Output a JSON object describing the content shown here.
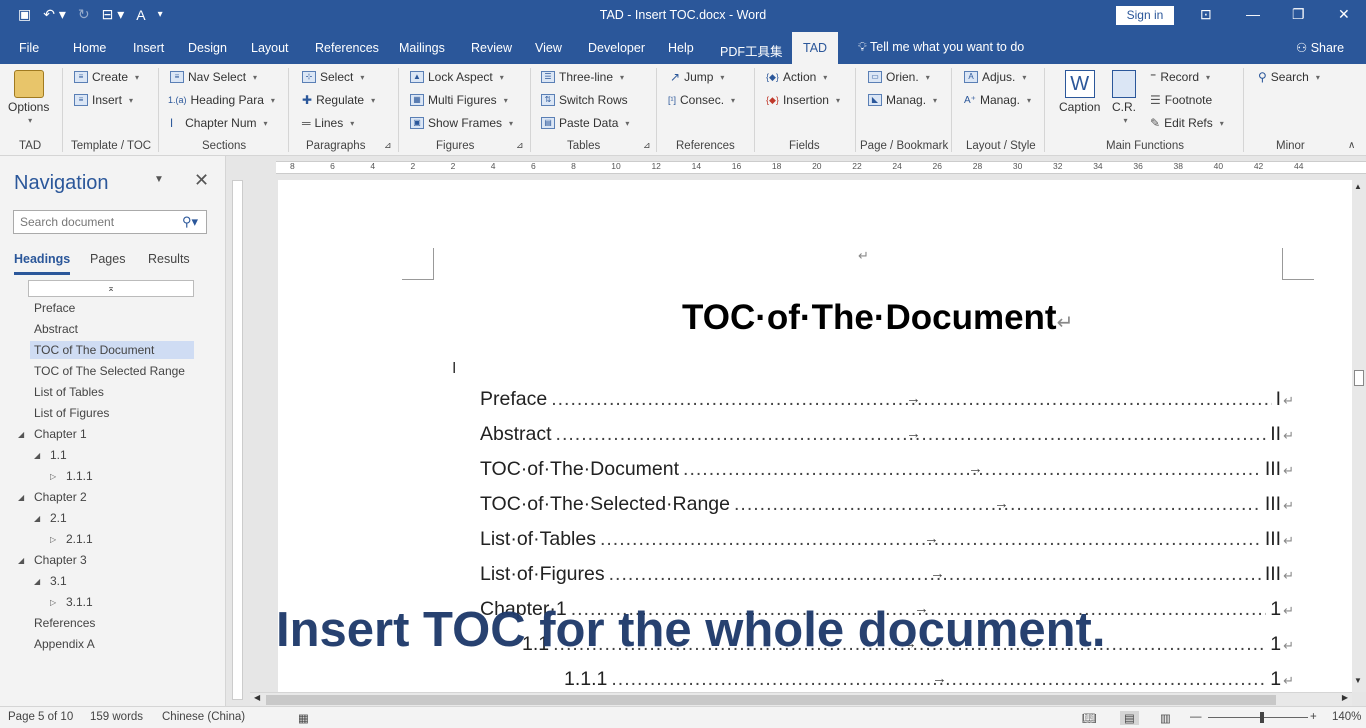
{
  "titlebar": {
    "title": "TAD - Insert TOC.docx - Word",
    "signin": "Sign in",
    "qat_icons": [
      "save-icon",
      "undo-icon",
      "redo-icon",
      "format-icon",
      "customize-icon"
    ]
  },
  "tabs": [
    "File",
    "Home",
    "Insert",
    "Design",
    "Layout",
    "References",
    "Mailings",
    "Review",
    "View",
    "Developer",
    "Help",
    "PDF工具集",
    "TAD"
  ],
  "active_tab": "TAD",
  "tellme": "Tell me what you want to do",
  "share": "Share",
  "ribbon": {
    "tad": {
      "options": "Options",
      "group": "TAD"
    },
    "template_toc": {
      "create": "Create",
      "insert": "Insert",
      "group": "Template / TOC"
    },
    "sections": {
      "nav_select": "Nav Select",
      "heading_para": "Heading Para",
      "chapter_num": "Chapter Num",
      "group": "Sections"
    },
    "paragraphs": {
      "select": "Select",
      "regulate": "Regulate",
      "lines": "Lines",
      "group": "Paragraphs"
    },
    "figures": {
      "lock_aspect": "Lock Aspect",
      "multi_figures": "Multi Figures",
      "show_frames": "Show Frames",
      "group": "Figures"
    },
    "tables": {
      "three_line": "Three-line",
      "switch_rows": "Switch Rows",
      "paste_data": "Paste Data",
      "group": "Tables"
    },
    "references": {
      "jump": "Jump",
      "consec": "Consec.",
      "group": "References"
    },
    "fields": {
      "action": "Action",
      "insertion": "Insertion",
      "group": "Fields"
    },
    "page_bookmark": {
      "orien": "Orien.",
      "manag": "Manag.",
      "group": "Page / Bookmark"
    },
    "layout_style": {
      "adjus": "Adjus.",
      "manag": "Manag.",
      "group": "Layout / Style"
    },
    "main_functions": {
      "caption": "Caption",
      "cr": "C.R.",
      "record": "Record",
      "footnote": "Footnote",
      "edit_refs": "Edit Refs",
      "group": "Main Functions"
    },
    "minor": {
      "search": "Search",
      "group": "Minor"
    }
  },
  "ruler_numbers": [
    "8",
    "6",
    "4",
    "2",
    "2",
    "4",
    "6",
    "8",
    "10",
    "12",
    "14",
    "16",
    "18",
    "20",
    "22",
    "24",
    "26",
    "28",
    "30",
    "32",
    "34",
    "36",
    "38",
    "40",
    "42",
    "44"
  ],
  "nav": {
    "title": "Navigation",
    "search_placeholder": "Search document",
    "tabs": [
      "Headings",
      "Pages",
      "Results"
    ],
    "headings": [
      {
        "label": "Preface",
        "level": 1,
        "selected": false
      },
      {
        "label": "Abstract",
        "level": 1,
        "selected": false
      },
      {
        "label": "TOC of The Document",
        "level": 1,
        "selected": true
      },
      {
        "label": "TOC of The Selected Range",
        "level": 1,
        "selected": false
      },
      {
        "label": "List of Tables",
        "level": 1,
        "selected": false
      },
      {
        "label": "List of Figures",
        "level": 1,
        "selected": false
      },
      {
        "label": "Chapter 1",
        "level": 1,
        "selected": false
      },
      {
        "label": "1.1",
        "level": 2,
        "selected": false
      },
      {
        "label": "1.1.1",
        "level": 3,
        "selected": false
      },
      {
        "label": "Chapter 2",
        "level": 1,
        "selected": false
      },
      {
        "label": "2.1",
        "level": 2,
        "selected": false
      },
      {
        "label": "2.1.1",
        "level": 3,
        "selected": false
      },
      {
        "label": "Chapter 3",
        "level": 1,
        "selected": false
      },
      {
        "label": "3.1",
        "level": 2,
        "selected": false
      },
      {
        "label": "3.1.1",
        "level": 3,
        "selected": false
      },
      {
        "label": "References",
        "level": 1,
        "selected": false
      },
      {
        "label": "Appendix A",
        "level": 1,
        "selected": false
      }
    ]
  },
  "document": {
    "return_mark": "↵",
    "heading": "TOC·of·The·Document",
    "toc": [
      {
        "title": "Preface",
        "page": "I"
      },
      {
        "title": "Abstract",
        "page": "II"
      },
      {
        "title": "TOC·of·The·Document",
        "page": "III"
      },
      {
        "title": "TOC·of·The·Selected·Range",
        "page": "III"
      },
      {
        "title": "List·of·Tables",
        "page": "III"
      },
      {
        "title": "List·of·Figures",
        "page": "III"
      },
      {
        "title": "Chapter·1",
        "page": "1"
      },
      {
        "title": "1.1",
        "page": "1"
      },
      {
        "title": "1.1.1",
        "page": "1"
      }
    ]
  },
  "overlay": "Insert TOC for the whole document.",
  "status": {
    "page": "Page 5 of 10",
    "words": "159 words",
    "language": "Chinese (China)",
    "zoom": "140%"
  }
}
